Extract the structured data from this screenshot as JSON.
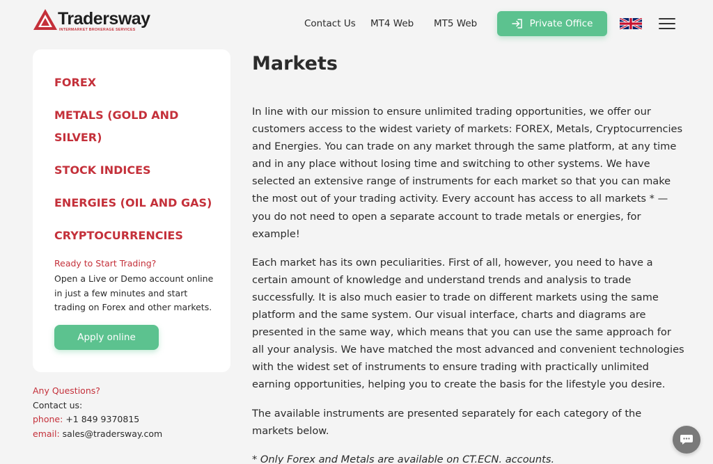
{
  "header": {
    "logo_text": "Tradersway",
    "logo_subtitle": "INTERMARKET BROKERAGE SERVICES",
    "nav": [
      {
        "label": "Contact Us"
      },
      {
        "label": "MT4 Web"
      },
      {
        "label": "MT5 Web"
      }
    ],
    "private_office_label": "Private Office",
    "language_icon": "uk-flag-icon",
    "menu_icon": "hamburger-icon"
  },
  "sidebar": {
    "categories": [
      {
        "label": "FOREX"
      },
      {
        "label": "METALS (GOLD AND SILVER)"
      },
      {
        "label": "STOCK INDICES"
      },
      {
        "label": "ENERGIES (OIL AND GAS)"
      },
      {
        "label": "CRYPTOCURRENCIES"
      }
    ],
    "ready_title": "Ready to Start Trading?",
    "ready_text": "Open a Live or Demo account online in just a few minutes and start trading on Forex and other markets.",
    "apply_label": "Apply online"
  },
  "contact": {
    "questions": "Any Questions?",
    "contact_us": "Contact us:",
    "phone_label": "phone:",
    "phone_value": "+1 849 9370815",
    "email_label": "email:",
    "email_value": "sales@tradersway.com"
  },
  "main": {
    "title": "Markets",
    "paragraphs": [
      "In line with our mission to ensure unlimited trading opportunities, we offer our customers access to the widest variety of markets: FOREX, Metals, Cryptocurrencies and Energies. You can trade on any market through the same platform, at any time and in any place without losing time and switching to other systems.  We have selected an extensive range of instruments for each market so that you can make the most out of your trading activity.  Every account has access to all markets * — you do not need to open a separate account to trade metals or energies, for example!",
      "Each market has its own peculiarities. First of all, however, you need to have a certain amount of knowledge and understand trends and analysis to trade successfully. It is also much easier to trade on different markets using the same platform and the same system. Our visual interface, charts and diagrams are presented in the same way, which means that you can use the same approach for all your analysis. We have matched the most advanced and convenient technologies with the widest set of instruments to ensure trading with practically unlimited earning opportunities, helping you to create the basis for the lifestyle you desire.",
      "The available instruments are presented separately for each category of the markets below."
    ],
    "note": "* Only Forex and Metals are available on CT.ECN. accounts."
  },
  "chat_icon": "chat-icon",
  "colors": {
    "brand_red": "#c4303a",
    "accent_green": "#5cc28f",
    "background": "#f4f4f4"
  }
}
